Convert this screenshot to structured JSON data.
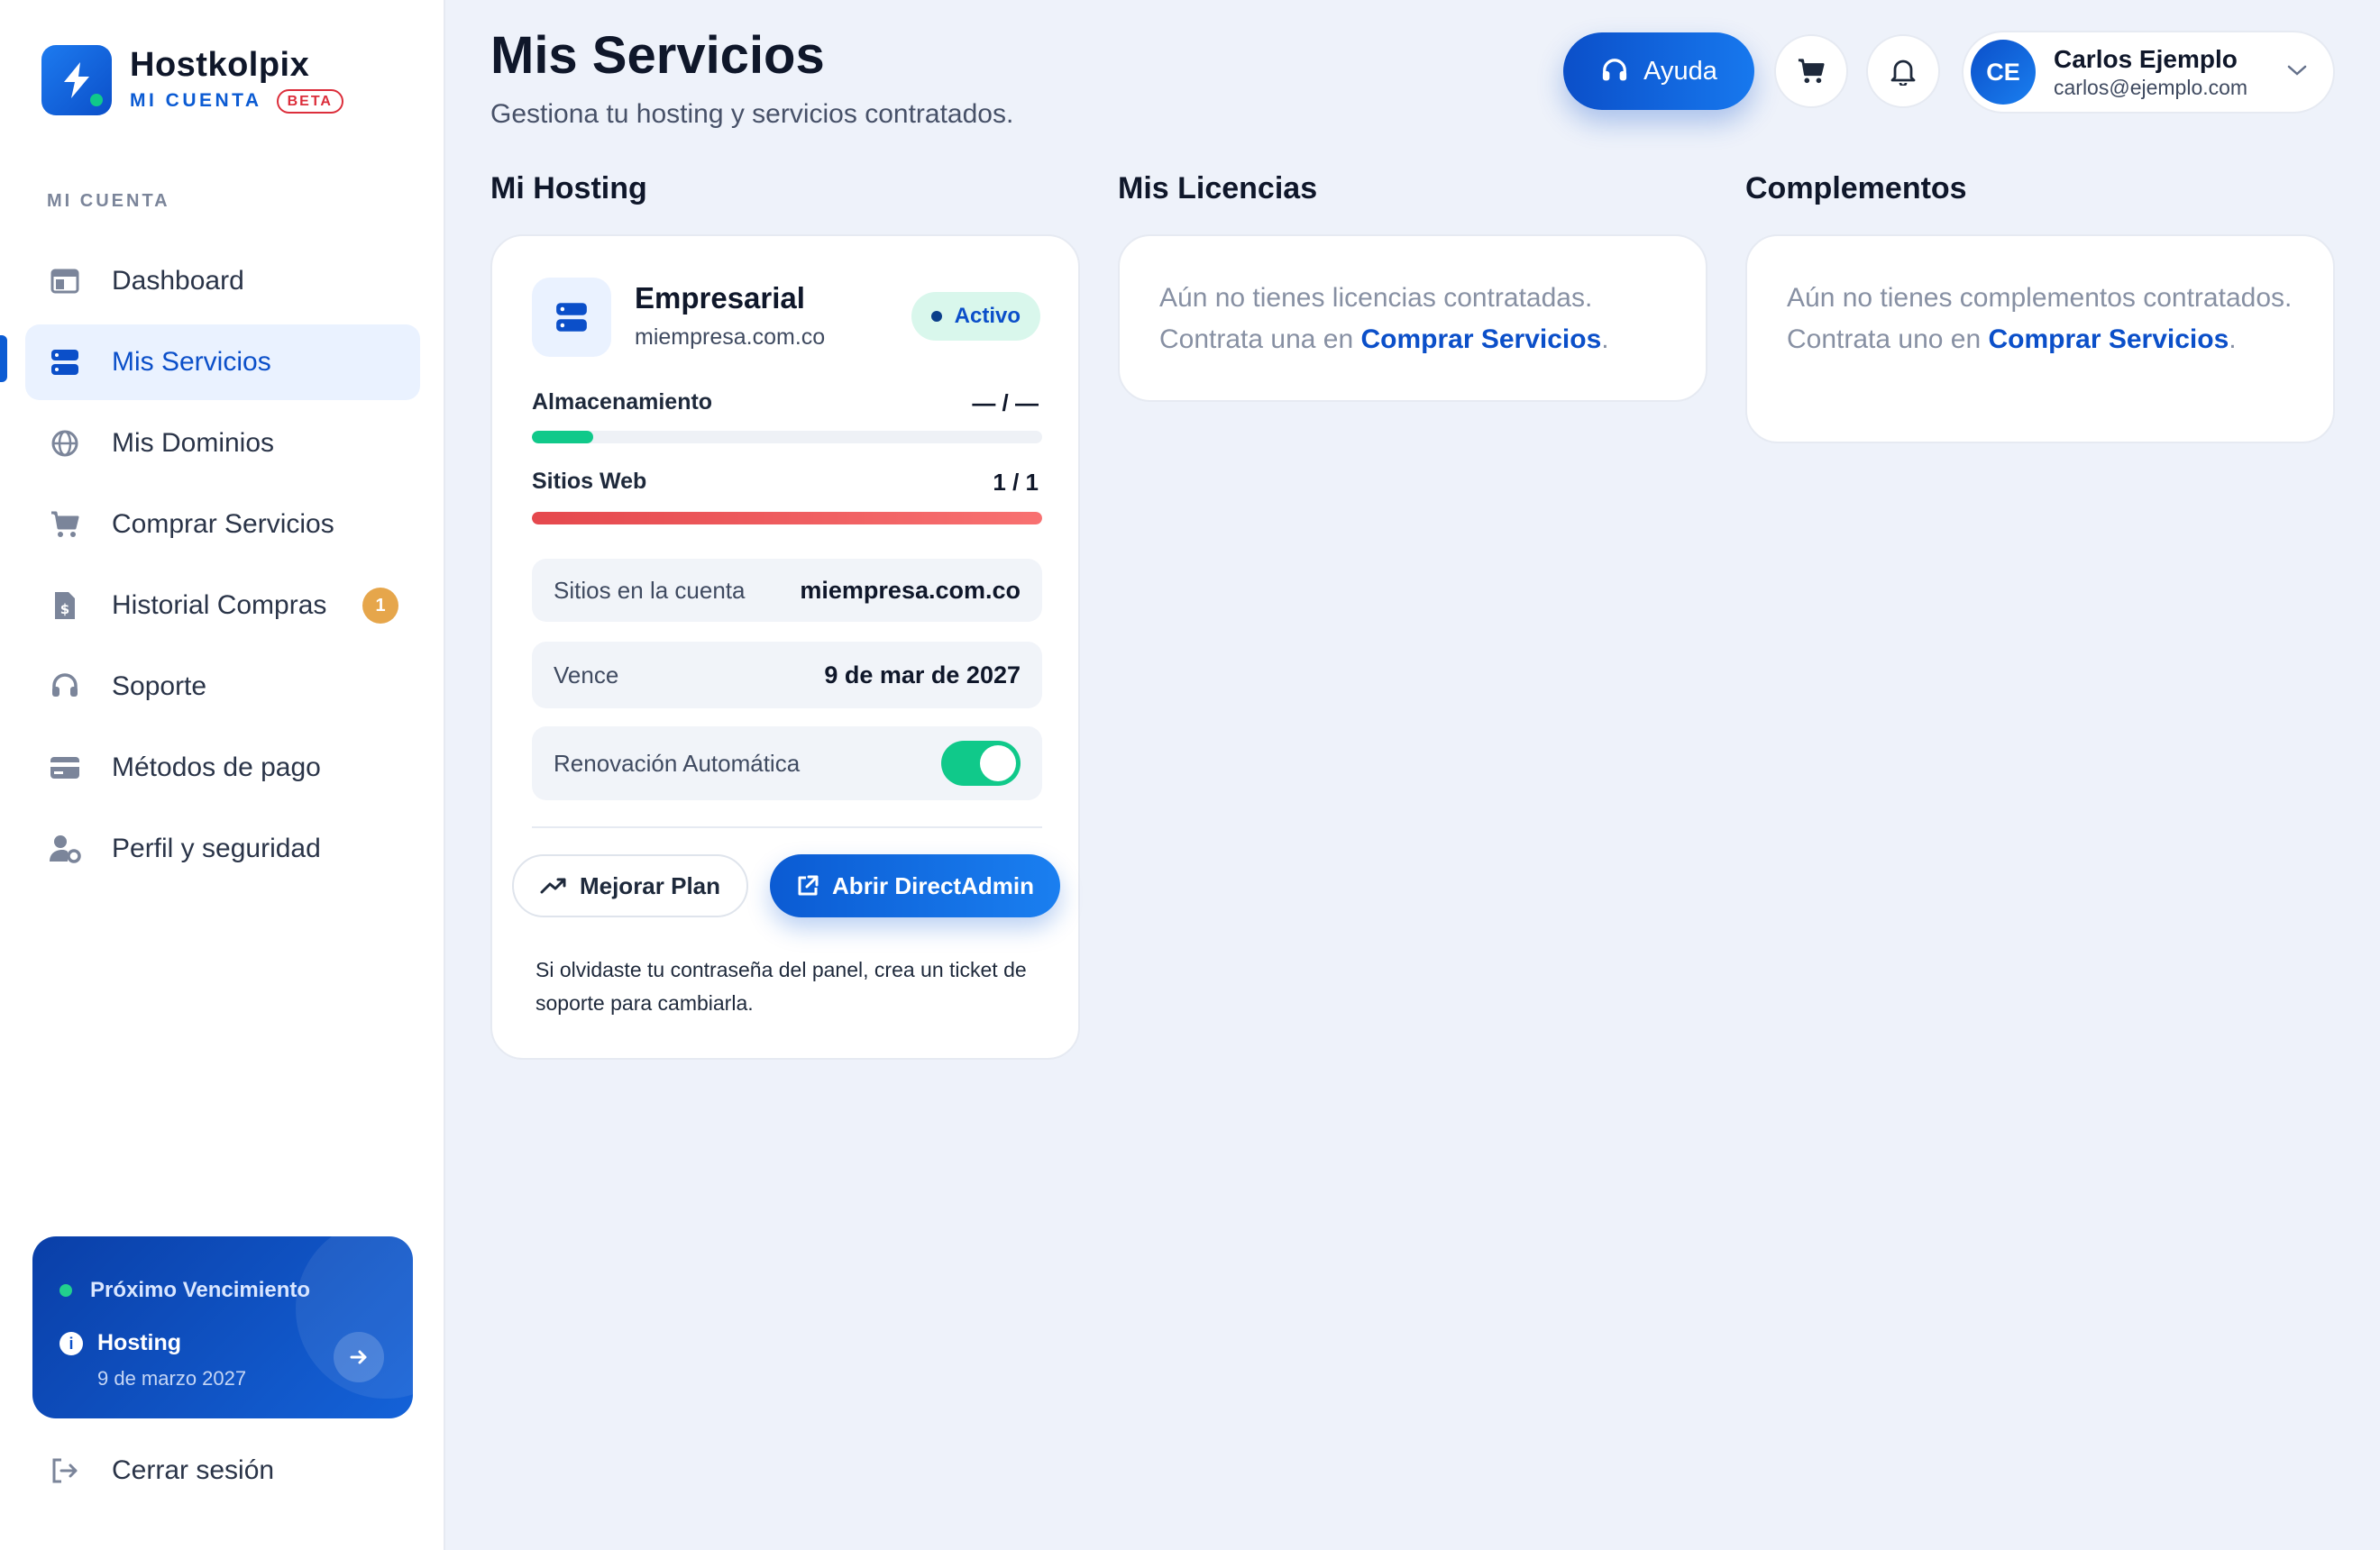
{
  "brand": {
    "name": "Hostkolpix",
    "subtitle": "MI CUENTA",
    "badge": "BETA"
  },
  "sidebar": {
    "section_label": "MI CUENTA",
    "items": [
      {
        "label": "Dashboard",
        "icon": "dashboard-icon",
        "active": false
      },
      {
        "label": "Mis Servicios",
        "icon": "server-icon",
        "active": true
      },
      {
        "label": "Mis Dominios",
        "icon": "globe-icon",
        "active": false
      },
      {
        "label": "Comprar Servicios",
        "icon": "cart-icon",
        "active": false
      },
      {
        "label": "Historial Compras",
        "icon": "invoice-icon",
        "active": false,
        "badge": "1"
      },
      {
        "label": "Soporte",
        "icon": "headset-icon",
        "active": false
      },
      {
        "label": "Métodos de pago",
        "icon": "credit-card-icon",
        "active": false
      },
      {
        "label": "Perfil y seguridad",
        "icon": "user-gear-icon",
        "active": false
      }
    ],
    "due_card": {
      "title": "Próximo Vencimiento",
      "item": "Hosting",
      "date": "9 de marzo 2027"
    },
    "logout_label": "Cerrar sesión"
  },
  "header": {
    "title": "Mis Servicios",
    "subtitle": "Gestiona tu hosting y servicios contratados.",
    "help_label": "Ayuda",
    "user": {
      "initials": "CE",
      "name": "Carlos Ejemplo",
      "email": "carlos@ejemplo.com"
    }
  },
  "hosting": {
    "section_title": "Mi Hosting",
    "plan": "Empresarial",
    "domain": "miempresa.com.co",
    "status": "Activo",
    "storage": {
      "label": "Almacenamiento",
      "value": "— / —",
      "fraction": 0.12
    },
    "sites": {
      "label": "Sitios Web",
      "value": "1 / 1",
      "fraction": 1.0
    },
    "sites_in_account": {
      "label": "Sitios en la cuenta",
      "value": "miempresa.com.co"
    },
    "expires": {
      "label": "Vence",
      "value": "9 de mar de 2027"
    },
    "auto_renew": {
      "label": "Renovación Automática",
      "enabled": true
    },
    "upgrade_label": "Mejorar Plan",
    "open_panel_label": "Abrir DirectAdmin",
    "note": "Si olvidaste tu contraseña del panel, crea un ticket de soporte para cambiarla."
  },
  "licenses": {
    "section_title": "Mis Licencias",
    "empty_text": "Aún no tienes licencias contratadas. Contrata una en ",
    "link": "Comprar Servicios",
    "suffix": "."
  },
  "addons": {
    "section_title": "Complementos",
    "empty_text": "Aún no tienes complementos contratados. Contrata uno en ",
    "link": "Comprar Servicios",
    "suffix": "."
  },
  "colors": {
    "accent": "#0b5bd3",
    "success": "#10c98a",
    "danger": "#e5484d",
    "badge": "#e6a64b"
  }
}
